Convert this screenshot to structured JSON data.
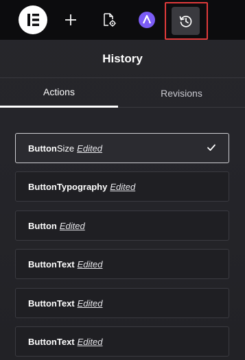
{
  "toolbar": {
    "icons": [
      "elementor-logo-icon",
      "plus-icon",
      "page-settings-icon",
      "ai-assistant-icon",
      "history-icon"
    ],
    "accent": "#e23b3b",
    "ai_color": "#7b5cf6"
  },
  "panel": {
    "title": "History"
  },
  "tabs": [
    {
      "label": "Actions",
      "active": true
    },
    {
      "label": "Revisions",
      "active": false
    }
  ],
  "history": {
    "items": [
      {
        "title": "Button Size",
        "title_bold": "Button",
        "title_rest": " Size",
        "action": "Edited",
        "active": true
      },
      {
        "title_bold": "Button",
        "title_rest": " Typography",
        "action": "Edited",
        "active": false
      },
      {
        "title_bold": "Button",
        "title_rest": "",
        "action": "Edited",
        "active": false
      },
      {
        "title_bold": "Button",
        "title_rest": " Text",
        "action": "Edited",
        "active": false
      },
      {
        "title_bold": "Button",
        "title_rest": " Text",
        "action": "Edited",
        "active": false
      },
      {
        "title_bold": "Button",
        "title_rest": " Text",
        "action": "Edited",
        "active": false
      }
    ]
  }
}
